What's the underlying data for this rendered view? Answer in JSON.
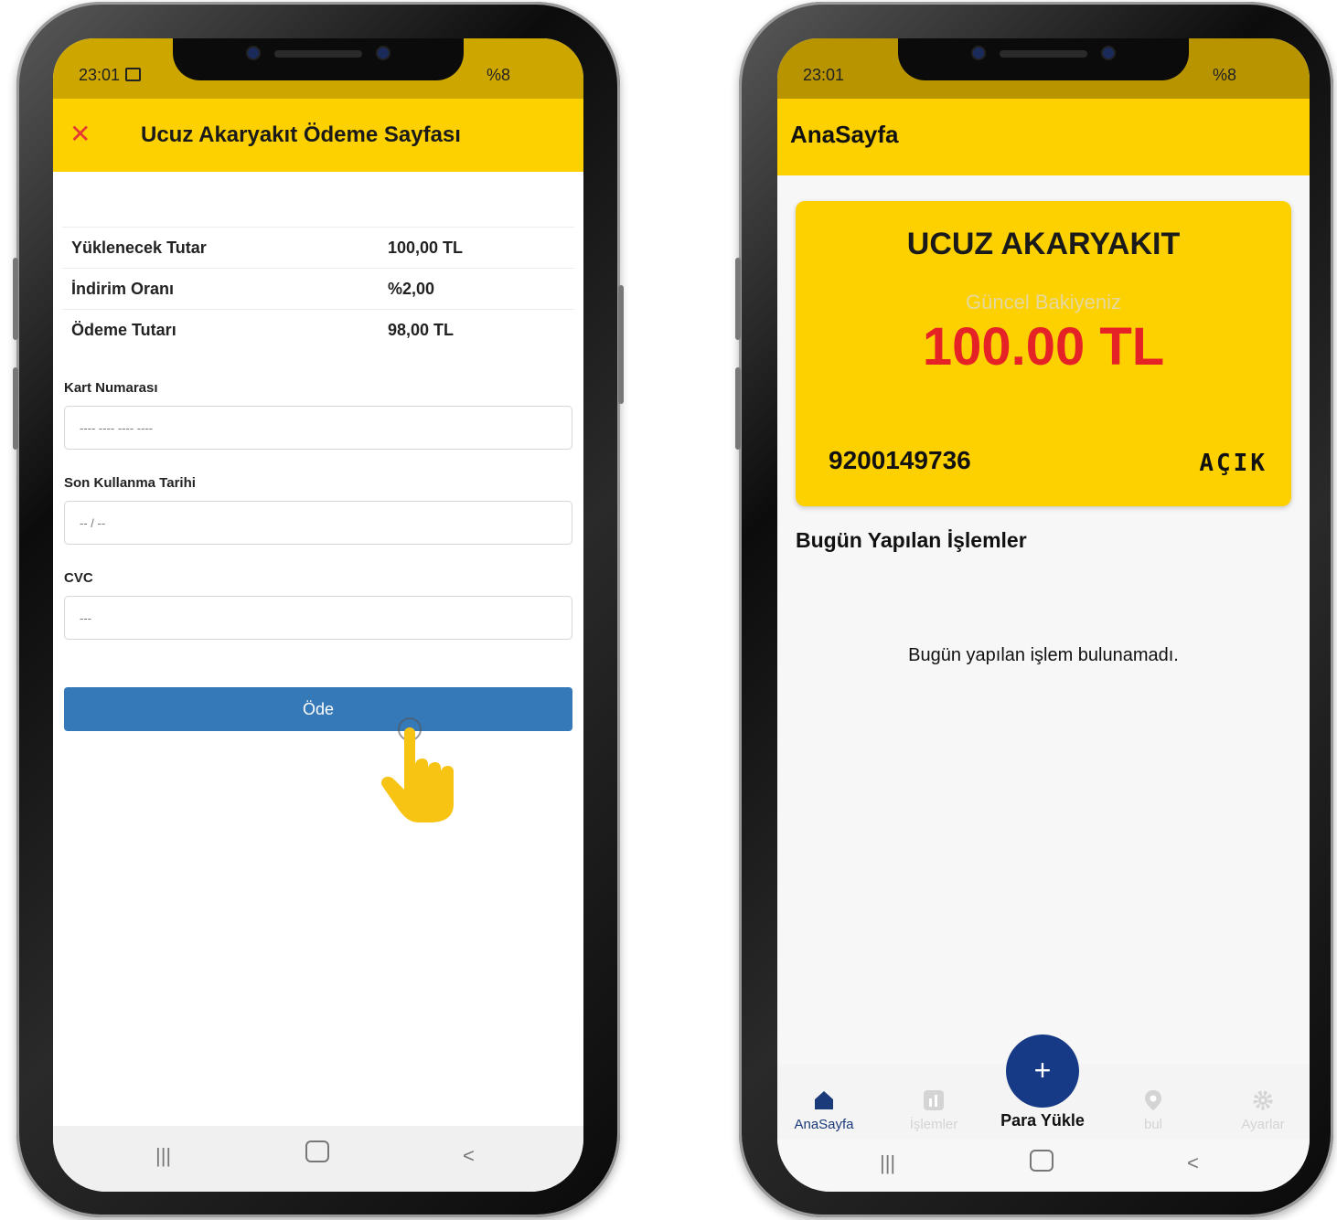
{
  "left_phone": {
    "status": {
      "time": "23:01",
      "battery": "%8"
    },
    "header": {
      "title": "Ucuz Akaryakıt Ödeme Sayfası"
    },
    "summary": [
      {
        "label": "Yüklenecek Tutar",
        "value": "100,00 TL"
      },
      {
        "label": "İndirim Oranı",
        "value": "%2,00"
      },
      {
        "label": "Ödeme Tutarı",
        "value": "98,00 TL"
      }
    ],
    "form": {
      "card_number": {
        "label": "Kart Numarası",
        "placeholder": "---- ---- ---- ----"
      },
      "expiry": {
        "label": "Son Kullanma Tarihi",
        "placeholder": "-- / --"
      },
      "cvc": {
        "label": "CVC",
        "placeholder": "---"
      }
    },
    "pay_button": "Öde"
  },
  "right_phone": {
    "status": {
      "time": "23:01",
      "battery": "%8"
    },
    "header": {
      "title": "AnaSayfa"
    },
    "card": {
      "title": "UCUZ AKARYAKIT",
      "balance_label": "Güncel Bakiyeniz",
      "balance": "100.00 TL",
      "card_number": "9200149736",
      "status": "AÇIK"
    },
    "section_title": "Bugün Yapılan İşlemler",
    "empty_message": "Bugün yapılan işlem bulunamadı.",
    "tabs": [
      "AnaSayfa",
      "İşlemler",
      "Para Yükle",
      "bul",
      "Ayarlar"
    ]
  },
  "colors": {
    "accent_yellow": "#fdd000",
    "pay_blue": "#3579b8",
    "fab_navy": "#163a85",
    "amount_red": "#e52326"
  }
}
